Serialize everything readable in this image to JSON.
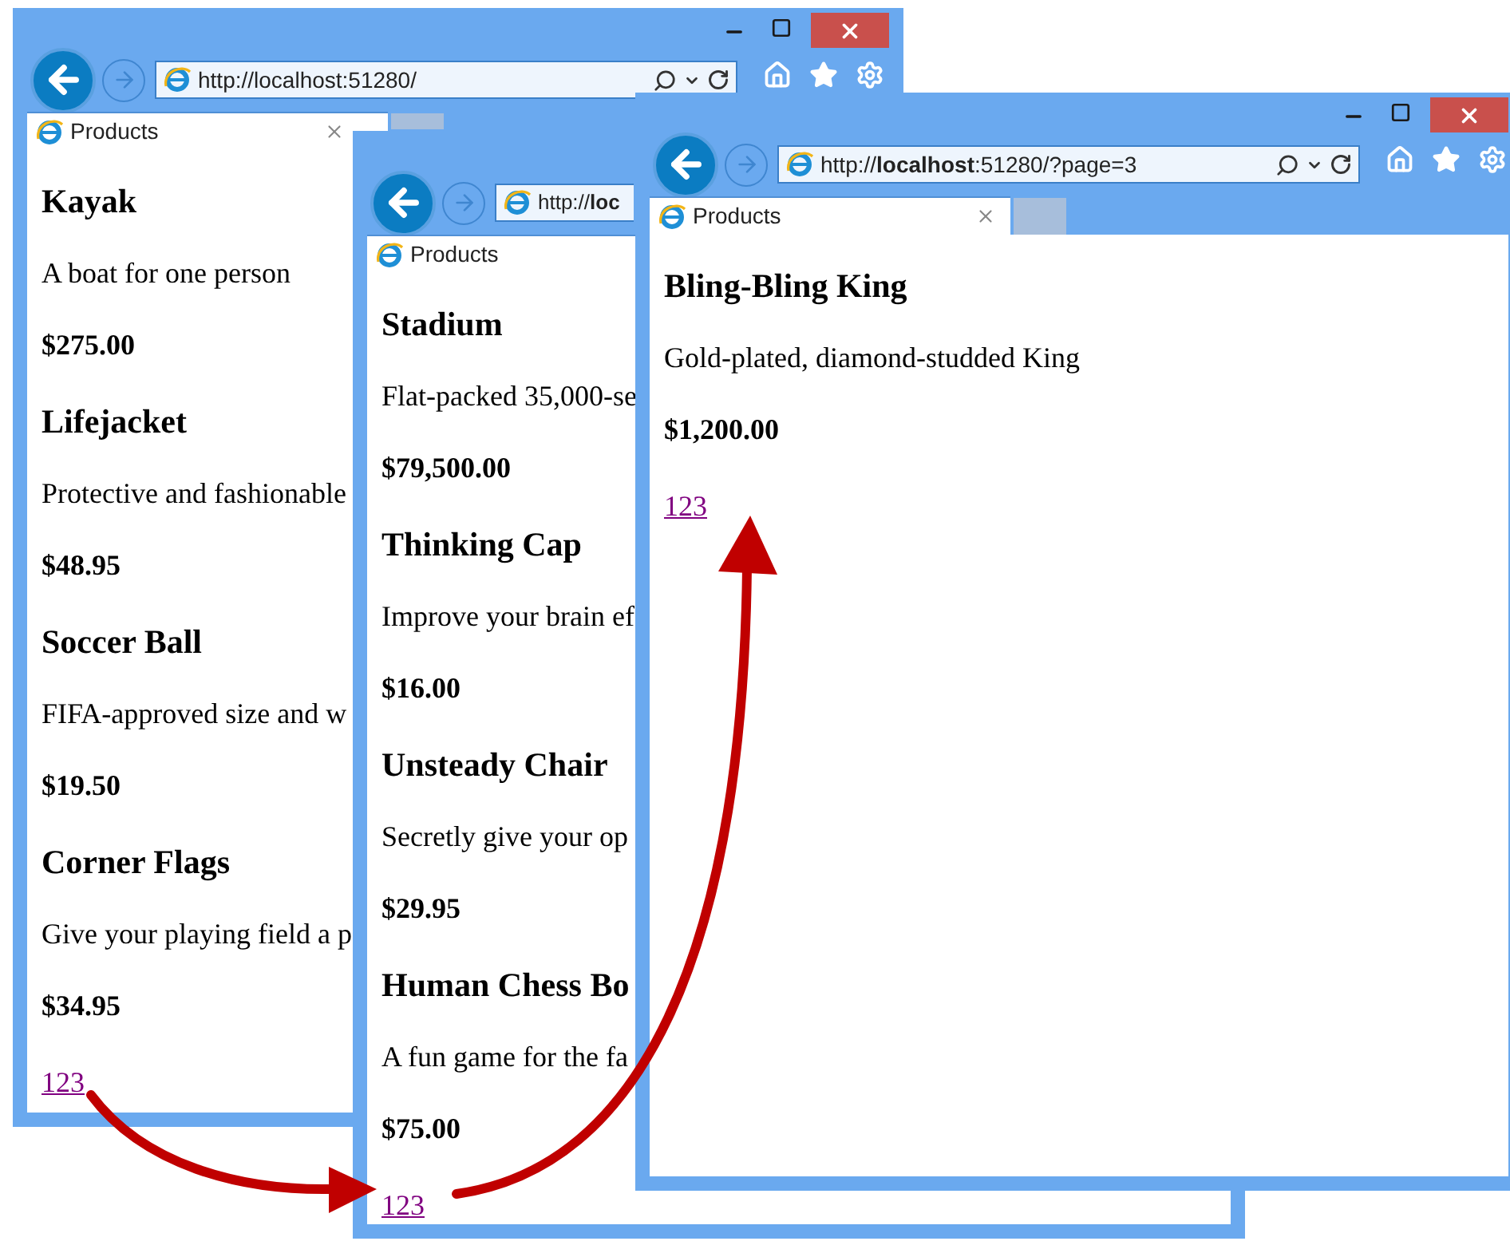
{
  "windows": [
    {
      "address": "http://localhost:51280/",
      "toolbar_icons": true,
      "tab_title": "Products",
      "tab_close": true,
      "products": [
        {
          "name": "Kayak",
          "description": "A boat for one person",
          "price": "$275.00"
        },
        {
          "name": "Lifejacket",
          "description": "Protective and fashionable",
          "price": "$48.95"
        },
        {
          "name": "Soccer Ball",
          "description": "FIFA-approved size and w",
          "price": "$19.50"
        },
        {
          "name": "Corner Flags",
          "description": "Give your playing field a p",
          "price": "$34.95"
        }
      ],
      "pagination": "123"
    },
    {
      "address": "http://**loc**",
      "toolbar_icons": false,
      "tab_title": "Products",
      "tab_close": false,
      "products": [
        {
          "name": "Stadium",
          "description": "Flat-packed 35,000-se",
          "price": "$79,500.00"
        },
        {
          "name": "Thinking Cap",
          "description": "Improve your brain ef",
          "price": "$16.00"
        },
        {
          "name": "Unsteady Chair",
          "description": "Secretly give your op",
          "price": "$29.95"
        },
        {
          "name": "Human Chess Bo",
          "description": "A fun game for the fa",
          "price": "$75.00"
        }
      ],
      "pagination": "123"
    },
    {
      "address": "http://**localhost**:51280/?page=3",
      "toolbar_icons": true,
      "tab_title": "Products",
      "tab_close": true,
      "products": [
        {
          "name": "Bling-Bling King",
          "description": "Gold-plated, diamond-studded King",
          "price": "$1,200.00"
        }
      ],
      "pagination": "123"
    }
  ]
}
